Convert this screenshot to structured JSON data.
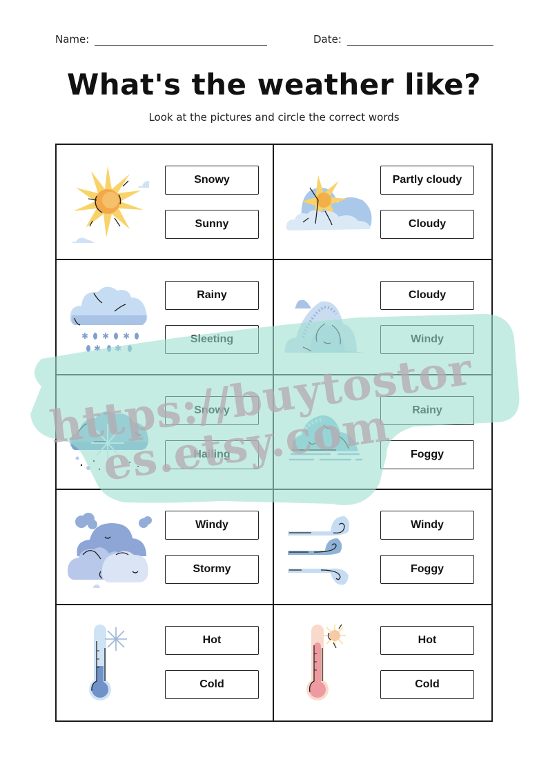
{
  "header": {
    "name_label": "Name:",
    "date_label": "Date:"
  },
  "title": "What's the weather like?",
  "subtitle": "Look at the pictures and circle the correct words",
  "cells": [
    {
      "picture": "sun-icon",
      "options": [
        "Snowy",
        "Sunny"
      ]
    },
    {
      "picture": "partly-cloudy-icon",
      "options": [
        "Partly cloudy",
        "Cloudy"
      ]
    },
    {
      "picture": "sleet-cloud-icon",
      "options": [
        "Rainy",
        "Sleeting"
      ]
    },
    {
      "picture": "cloud-icon",
      "options": [
        "Cloudy",
        "Windy"
      ]
    },
    {
      "picture": "snow-cloud-icon",
      "options": [
        "Snowy",
        "Hailing"
      ]
    },
    {
      "picture": "fog-cloud-icon",
      "options": [
        "Rainy",
        "Foggy"
      ]
    },
    {
      "picture": "storm-clouds-icon",
      "options": [
        "Windy",
        "Stormy"
      ]
    },
    {
      "picture": "wind-icon",
      "options": [
        "Windy",
        "Foggy"
      ]
    },
    {
      "picture": "cold-thermometer-icon",
      "options": [
        "Hot",
        "Cold"
      ]
    },
    {
      "picture": "hot-thermometer-icon",
      "options": [
        "Hot",
        "Cold"
      ]
    }
  ],
  "watermark": {
    "line1": "https://buytostor",
    "line2": "es.etsy.com",
    "color": "#b8ebe0"
  },
  "colors": {
    "sun": "#f7c948",
    "sun_core": "#f3a84a",
    "cloud_light": "#dbe9f7",
    "cloud_mid": "#a9c8ea",
    "cloud_dark": "#8ea6d6",
    "thermo_cold": "#6f93c9",
    "thermo_hot": "#ef9aa0"
  }
}
